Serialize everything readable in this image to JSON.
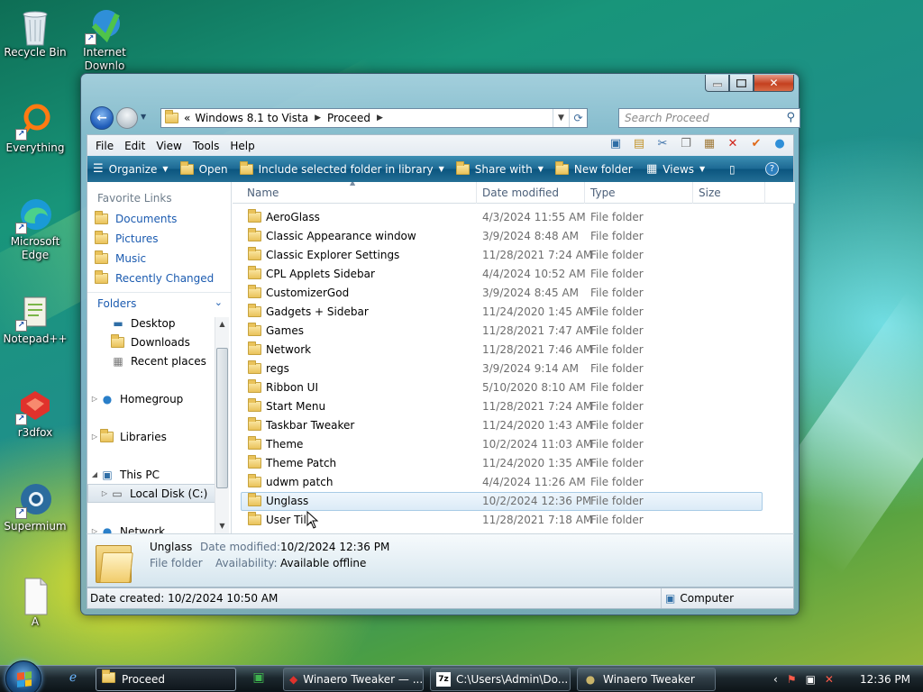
{
  "desktop": {
    "icons": [
      {
        "label": "Recycle Bin"
      },
      {
        "label": "Internet Downlo"
      },
      {
        "label": "Everything"
      },
      {
        "label": "Microsoft Edge"
      },
      {
        "label": "Notepad++"
      },
      {
        "label": "r3dfox"
      },
      {
        "label": "Supermium"
      },
      {
        "label": "A"
      }
    ]
  },
  "window": {
    "address": {
      "overflow": "«",
      "crumbs": [
        "Windows 8.1 to Vista",
        "Proceed"
      ]
    },
    "search": {
      "placeholder": "Search Proceed"
    },
    "menu": [
      "File",
      "Edit",
      "View",
      "Tools",
      "Help"
    ],
    "commands": {
      "organize": "Organize",
      "open": "Open",
      "include": "Include selected folder in library",
      "share": "Share with",
      "new_folder": "New folder",
      "views": "Views"
    },
    "nav": {
      "favorites_header": "Favorite Links",
      "favorites": [
        "Documents",
        "Pictures",
        "Music",
        "Recently Changed"
      ],
      "folders_header": "Folders",
      "tree": {
        "desktop": "Desktop",
        "downloads": "Downloads",
        "recent": "Recent places",
        "homegroup": "Homegroup",
        "libraries": "Libraries",
        "thispc": "This PC",
        "localdisk": "Local Disk (C:)",
        "network": "Network"
      }
    },
    "columns": {
      "name": "Name",
      "date": "Date modified",
      "type": "Type",
      "size": "Size"
    },
    "files": [
      {
        "name": "AeroGlass",
        "date": "4/3/2024 11:55 AM",
        "type": "File folder"
      },
      {
        "name": "Classic Appearance window",
        "date": "3/9/2024 8:48 AM",
        "type": "File folder"
      },
      {
        "name": "Classic Explorer Settings",
        "date": "11/28/2021 7:24 AM",
        "type": "File folder"
      },
      {
        "name": "CPL Applets Sidebar",
        "date": "4/4/2024 10:52 AM",
        "type": "File folder"
      },
      {
        "name": "CustomizerGod",
        "date": "3/9/2024 8:45 AM",
        "type": "File folder"
      },
      {
        "name": "Gadgets + Sidebar",
        "date": "11/24/2020 1:45 AM",
        "type": "File folder"
      },
      {
        "name": "Games",
        "date": "11/28/2021 7:47 AM",
        "type": "File folder"
      },
      {
        "name": "Network",
        "date": "11/28/2021 7:46 AM",
        "type": "File folder"
      },
      {
        "name": "regs",
        "date": "3/9/2024 9:14 AM",
        "type": "File folder"
      },
      {
        "name": "Ribbon UI",
        "date": "5/10/2020 8:10 AM",
        "type": "File folder"
      },
      {
        "name": "Start Menu",
        "date": "11/28/2021 7:24 AM",
        "type": "File folder"
      },
      {
        "name": "Taskbar Tweaker",
        "date": "11/24/2020 1:43 AM",
        "type": "File folder"
      },
      {
        "name": "Theme",
        "date": "10/2/2024 11:03 AM",
        "type": "File folder"
      },
      {
        "name": "Theme Patch",
        "date": "11/24/2020 1:35 AM",
        "type": "File folder"
      },
      {
        "name": "udwm patch",
        "date": "4/4/2024 11:26 AM",
        "type": "File folder"
      },
      {
        "name": "Unglass",
        "date": "10/2/2024 12:36 PM",
        "type": "File folder"
      },
      {
        "name": "User Tile",
        "date": "11/28/2021 7:18 AM",
        "type": "File folder"
      }
    ],
    "selected_index": 15,
    "details": {
      "name": "Unglass",
      "date_key": "Date modified:",
      "date_val": "10/2/2024 12:36 PM",
      "type": "File folder",
      "avail_key": "Availability:",
      "avail_val": "Available offline"
    },
    "status": {
      "left": "Date created: 10/2/2024 10:50 AM",
      "right": "Computer"
    }
  },
  "taskbar": {
    "buttons": [
      {
        "label": "Proceed"
      },
      {
        "label": "Winaero Tweaker — ..."
      },
      {
        "label": "C:\\Users\\Admin\\Do..."
      },
      {
        "label": "Winaero Tweaker"
      }
    ],
    "clock": "12:36 PM"
  },
  "colors": {
    "accent": "#1b5bb0",
    "command_bar": "#1d6a94",
    "selection": "#dcebf7"
  }
}
